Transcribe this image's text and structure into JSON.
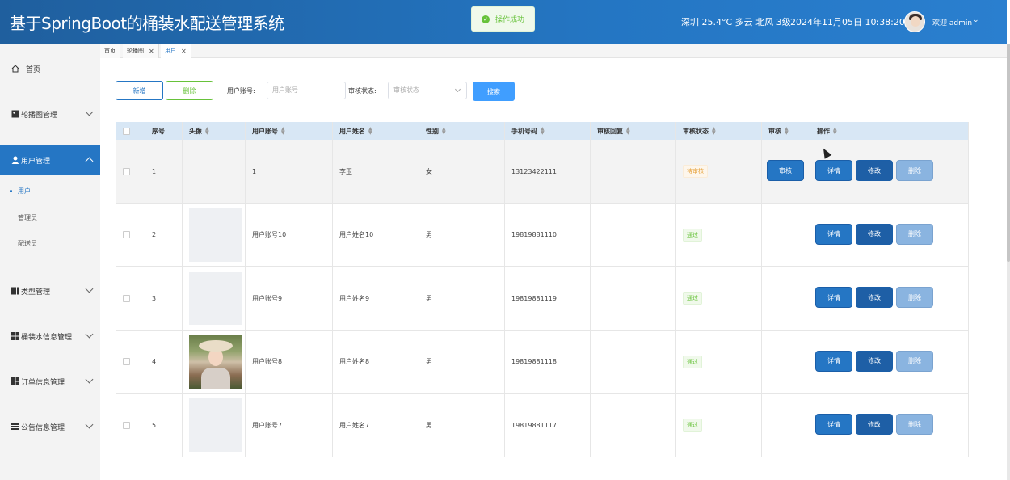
{
  "header": {
    "title": "基于SpringBoot的桶装水配送管理系统",
    "toast": "操作成功",
    "weather": "深圳 25.4°C 多云 北风 3级",
    "datetime": "2024年11月05日 10:38:20",
    "welcome": "欢迎 admin",
    "colors": {
      "header_bg": "#2476c3",
      "accent": "#2576c4",
      "success": "#67c23a",
      "warning": "#e6a23c"
    }
  },
  "sidebar": {
    "items": [
      {
        "label": "首页",
        "icon": "home-icon"
      },
      {
        "label": "轮播图管理",
        "icon": "image-icon"
      },
      {
        "label": "用户管理",
        "icon": "user-icon",
        "active": true
      },
      {
        "label": "类型管理",
        "icon": "type-icon"
      },
      {
        "label": "桶装水信息管理",
        "icon": "grid-icon"
      },
      {
        "label": "订单信息管理",
        "icon": "order-icon"
      },
      {
        "label": "公告信息管理",
        "icon": "notice-icon"
      }
    ],
    "sub_items": [
      "用户",
      "管理员",
      "配送员"
    ]
  },
  "tabs": [
    {
      "label": "首页"
    },
    {
      "label": "轮播图",
      "close": "✕"
    },
    {
      "label": "用户",
      "close": "✕",
      "active": true
    }
  ],
  "toolbar": {
    "add_label": "新增",
    "delete_label": "删除",
    "account_label": "用户账号:",
    "account_placeholder": "用户账号",
    "status_label": "审核状态:",
    "status_placeholder": "审核状态",
    "search_label": "搜索"
  },
  "table": {
    "columns": [
      "序号",
      "头像",
      "用户账号",
      "用户姓名",
      "性别",
      "手机号码",
      "审核回复",
      "审核状态",
      "审核",
      "操作"
    ],
    "rows": [
      {
        "index": "1",
        "account": "1",
        "name": "李玉",
        "gender": "女",
        "phone": "13123422111",
        "reply": "",
        "status": "待审核",
        "status_type": "pending",
        "has_audit": true,
        "avatar": "none"
      },
      {
        "index": "2",
        "account": "用户账号10",
        "name": "用户姓名10",
        "gender": "男",
        "phone": "19819881110",
        "reply": "",
        "status": "通过",
        "status_type": "ok",
        "has_audit": false,
        "avatar": "blank"
      },
      {
        "index": "3",
        "account": "用户账号9",
        "name": "用户姓名9",
        "gender": "男",
        "phone": "19819881119",
        "reply": "",
        "status": "通过",
        "status_type": "ok",
        "has_audit": false,
        "avatar": "blank"
      },
      {
        "index": "4",
        "account": "用户账号8",
        "name": "用户姓名8",
        "gender": "男",
        "phone": "19819881118",
        "reply": "",
        "status": "通过",
        "status_type": "ok",
        "has_audit": false,
        "avatar": "photo"
      },
      {
        "index": "5",
        "account": "用户账号7",
        "name": "用户姓名7",
        "gender": "男",
        "phone": "19819881117",
        "reply": "",
        "status": "通过",
        "status_type": "ok",
        "has_audit": false,
        "avatar": "blank"
      }
    ],
    "actions": {
      "audit": "审核",
      "detail": "详情",
      "edit": "修改",
      "delete": "删除"
    }
  }
}
